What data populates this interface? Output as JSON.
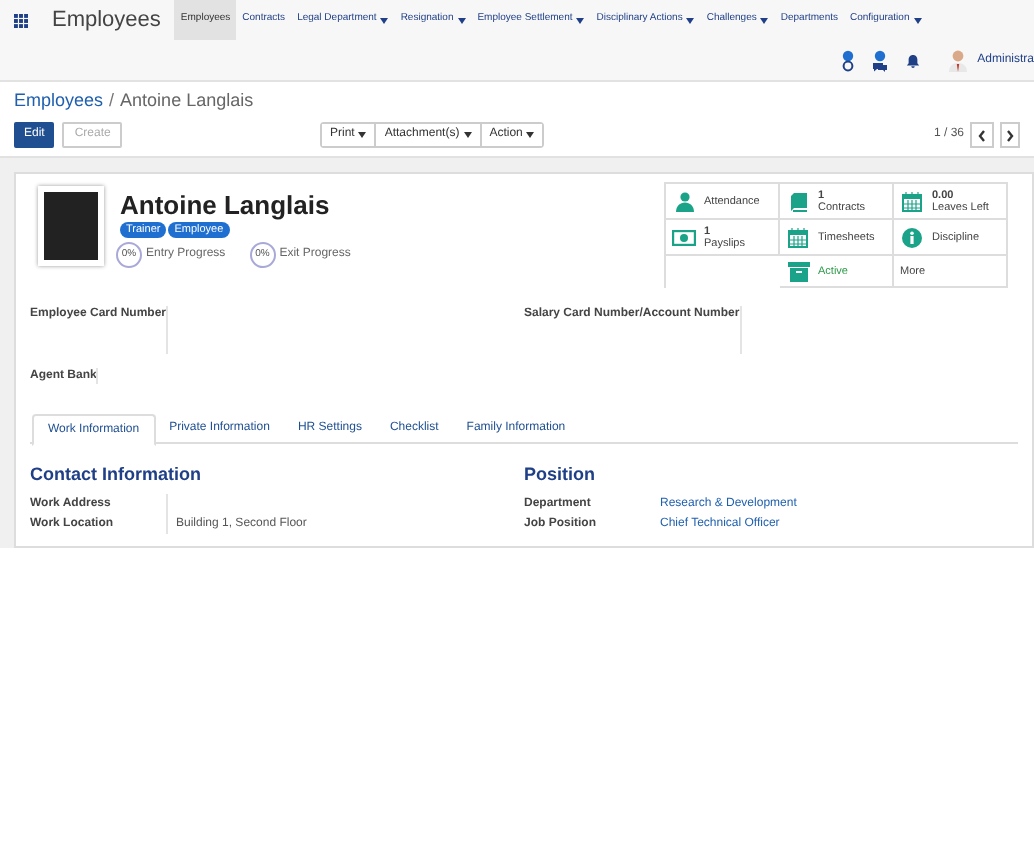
{
  "app": {
    "title": "Employees"
  },
  "menu": [
    {
      "label": "Employees",
      "selected": true,
      "dropdown": false
    },
    {
      "label": "Contracts",
      "selected": false,
      "dropdown": false
    },
    {
      "label": "Legal Department",
      "selected": false,
      "dropdown": true
    },
    {
      "label": "Resignation",
      "selected": false,
      "dropdown": true
    },
    {
      "label": "Employee Settlement",
      "selected": false,
      "dropdown": true
    },
    {
      "label": "Disciplinary Actions",
      "selected": false,
      "dropdown": true
    },
    {
      "label": "Challenges",
      "selected": false,
      "dropdown": true
    },
    {
      "label": "Departments",
      "selected": false,
      "dropdown": false
    },
    {
      "label": "Configuration",
      "selected": false,
      "dropdown": true
    }
  ],
  "user": {
    "name": "Administra"
  },
  "breadcrumb": [
    {
      "label": "Employees",
      "link": true,
      "separator": "/"
    },
    {
      "label": "Antoine Langlais",
      "link": false
    }
  ],
  "buttons": [
    {
      "label": "Edit",
      "primary": true
    },
    {
      "label": "Create",
      "primary": false
    }
  ],
  "toolbar": [
    {
      "label": "Print"
    },
    {
      "label": "Attachment(s)"
    },
    {
      "label": "Action"
    }
  ],
  "pager": "1 / 36",
  "employee": {
    "name": "Antoine Langlais",
    "tags": [
      "Trainer",
      "Employee"
    ],
    "progress": [
      {
        "value": "0%",
        "label": "Entry Progress"
      },
      {
        "value": "0%",
        "label": "Exit Progress"
      }
    ]
  },
  "smart_buttons": [
    {
      "kind": "person",
      "label": "Attendance"
    },
    {
      "kind": "book",
      "count": "1",
      "label": "Contracts"
    },
    {
      "kind": "calendar",
      "count": "0.00",
      "label": "Leaves Left"
    },
    {
      "kind": "money",
      "count": "1",
      "label": "Payslips"
    },
    {
      "kind": "calendar",
      "label": "Timesheets"
    },
    {
      "kind": "info",
      "label": "Discipline"
    },
    {
      "kind": "blank"
    },
    {
      "kind": "archive",
      "label": "Active"
    },
    {
      "kind": "more",
      "label": "More"
    }
  ],
  "fields_left": [
    {
      "label": "Employee Card Number"
    },
    {
      "label": "Agent Bank"
    }
  ],
  "fields_right": [
    {
      "label": "Salary Card Number/Account Number"
    }
  ],
  "tabs": [
    {
      "label": "Work Information",
      "selected": true
    },
    {
      "label": "Private Information",
      "selected": false
    },
    {
      "label": "HR Settings",
      "selected": false
    },
    {
      "label": "Checklist",
      "selected": false
    },
    {
      "label": "Family Information",
      "selected": false
    }
  ],
  "sections": [
    {
      "title": "Contact Information",
      "fields": [
        {
          "label": "Work Address"
        },
        {
          "label": "Work Location",
          "value": "Building 1, Second Floor"
        }
      ]
    },
    {
      "title": "Position",
      "fields": [
        {
          "label": "Department",
          "value": "Research & Development"
        },
        {
          "label": "Job Position",
          "value": "Chief Technical Officer"
        }
      ]
    }
  ]
}
